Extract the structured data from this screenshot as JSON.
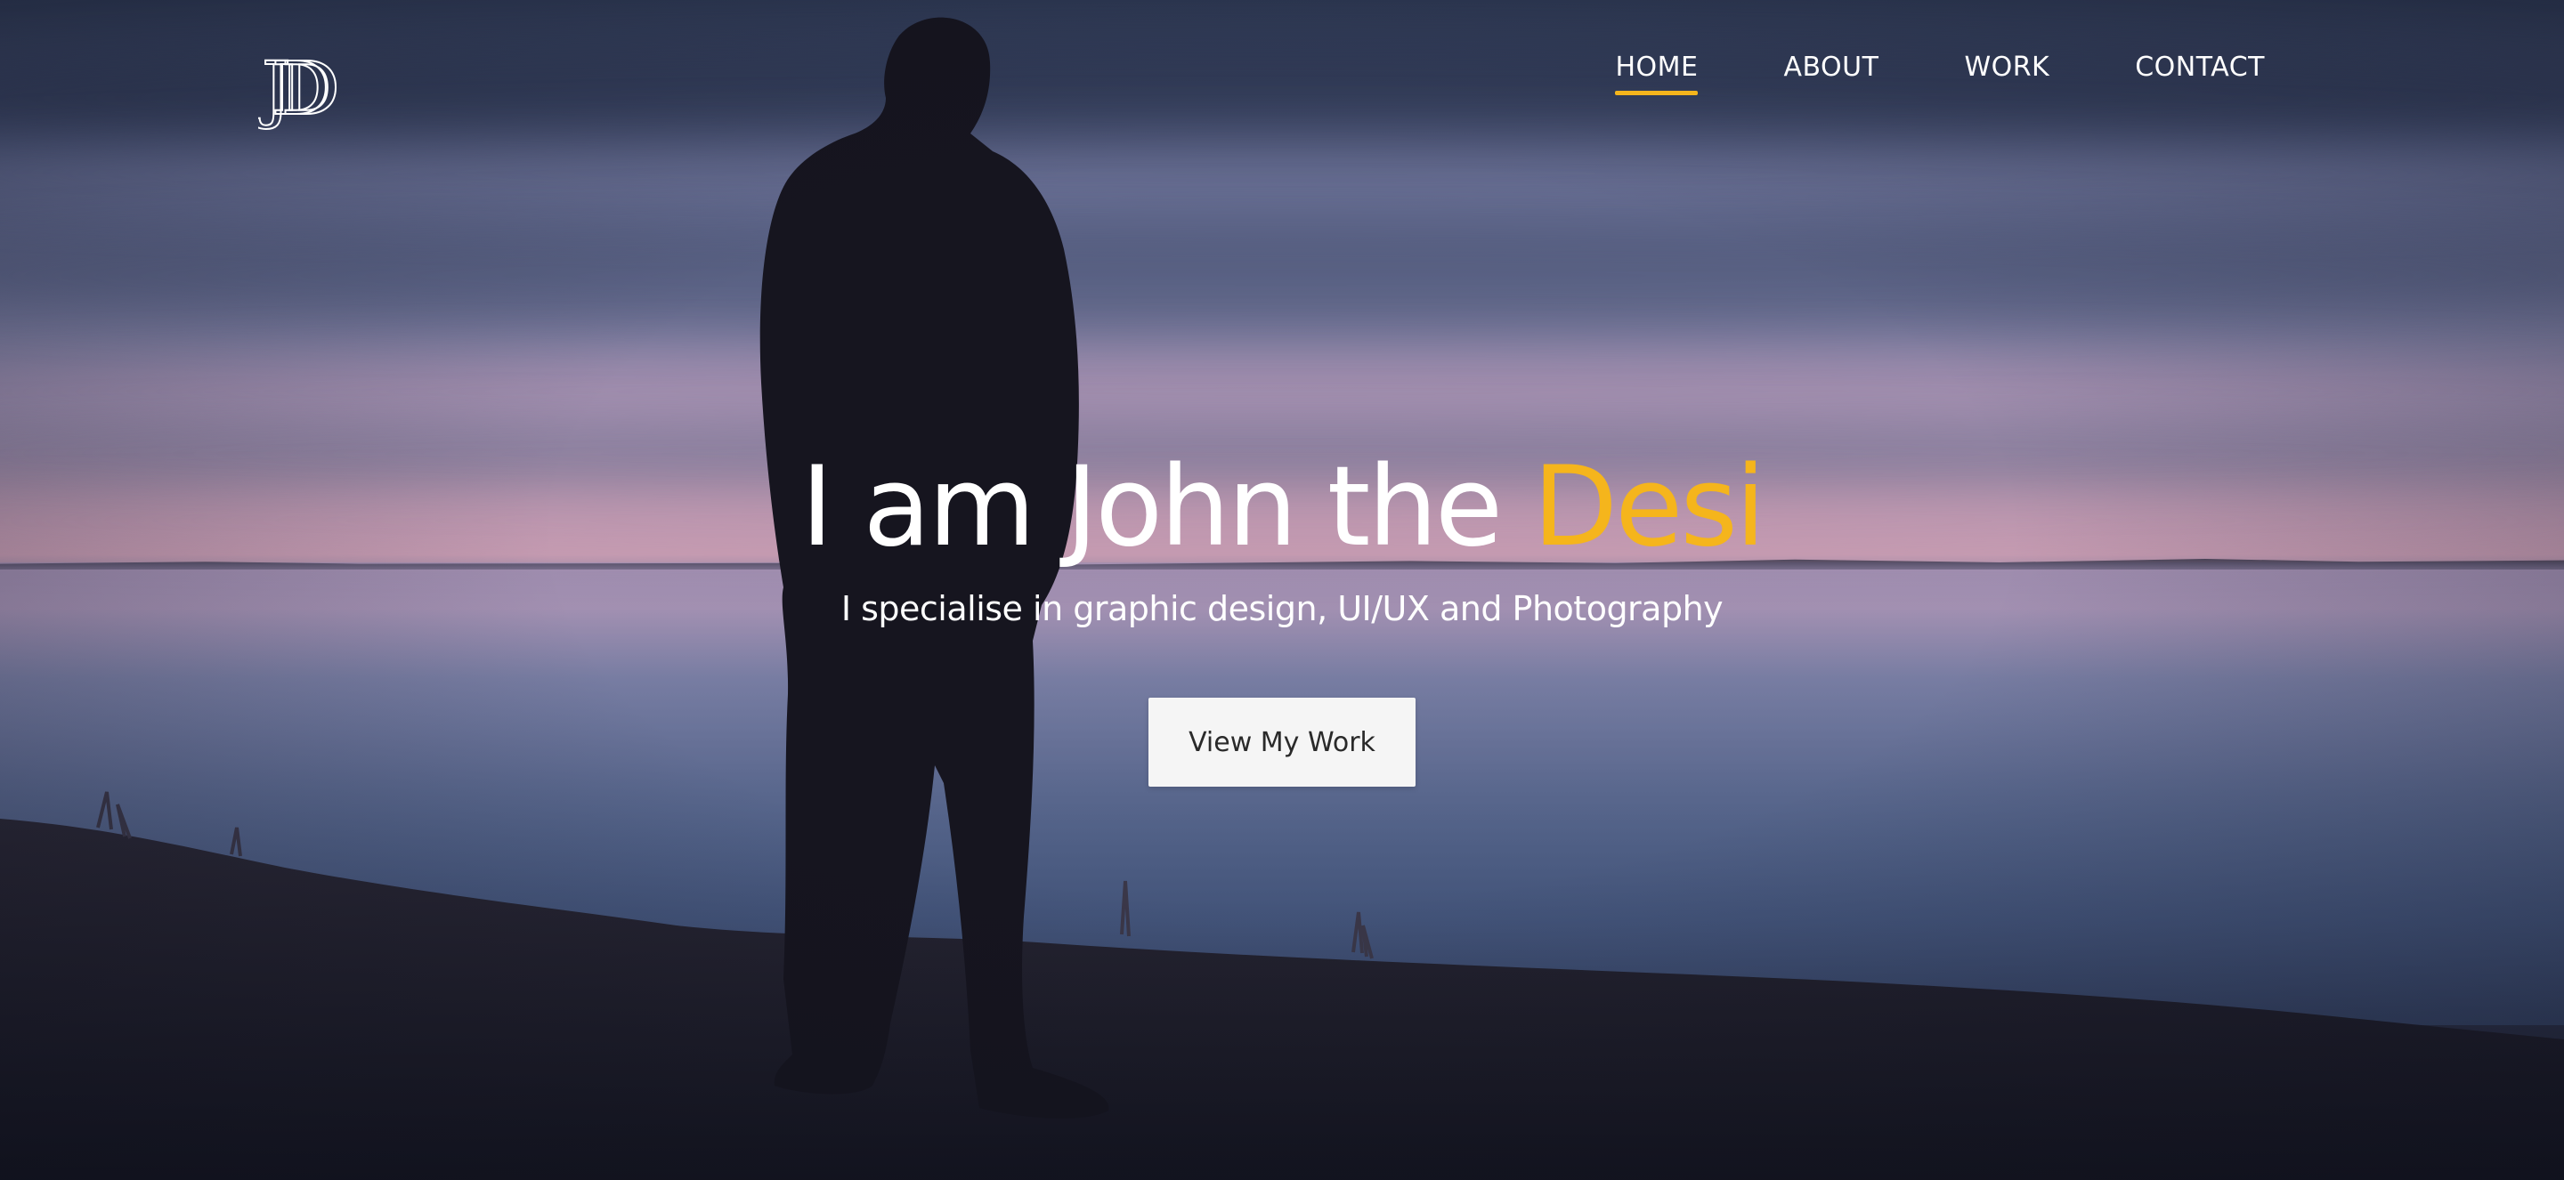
{
  "brand": {
    "logo_text": "JD"
  },
  "nav": {
    "items": [
      {
        "label": "HOME",
        "active": true
      },
      {
        "label": "ABOUT",
        "active": false
      },
      {
        "label": "WORK",
        "active": false
      },
      {
        "label": "CONTACT",
        "active": false
      }
    ]
  },
  "hero": {
    "headline_prefix": "I am John the ",
    "headline_accent": "Desi",
    "subheadline": "I specialise in graphic design, UI/UX and Photography",
    "cta_label": "View My Work"
  },
  "colors": {
    "accent": "#f5b51c",
    "text": "#ffffff",
    "button_bg": "#f5f5f5",
    "button_text": "#2a2a2a"
  },
  "icons": {
    "logo": "jd-monogram-logo"
  }
}
